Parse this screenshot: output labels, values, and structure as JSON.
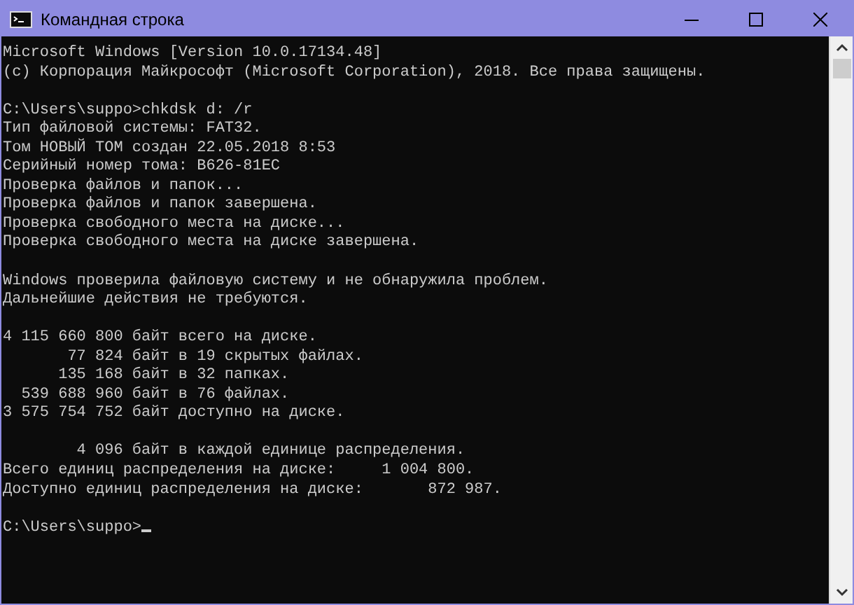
{
  "window": {
    "title": "Командная строка"
  },
  "console": {
    "blocks": [
      [
        "Microsoft Windows [Version 10.0.17134.48]",
        "(c) Корпорация Майкрософт (Microsoft Corporation), 2018. Все права защищены."
      ],
      [
        "C:\\Users\\suppo>chkdsk d: /r",
        "Тип файловой системы: FAT32.",
        "Том НОВЫЙ ТОМ создан 22.05.2018 8:53",
        "Серийный номер тома: B626-81EC",
        "Проверка файлов и папок...",
        "Проверка файлов и папок завершена.",
        "Проверка свободного места на диске...",
        "Проверка свободного места на диске завершена."
      ],
      [
        "Windows проверила файловую систему и не обнаружила проблем.",
        "Дальнейшие действия не требуются."
      ],
      [
        "4 115 660 800 байт всего на диске.",
        "       77 824 байт в 19 скрытых файлах.",
        "      135 168 байт в 32 папках.",
        "  539 688 960 байт в 76 файлах.",
        "3 575 754 752 байт доступно на диске."
      ],
      [
        "        4 096 байт в каждой единице распределения.",
        "Всего единиц распределения на диске:     1 004 800.",
        "Доступно единиц распределения на диске:       872 987."
      ]
    ],
    "prompt": "C:\\Users\\suppo>"
  }
}
